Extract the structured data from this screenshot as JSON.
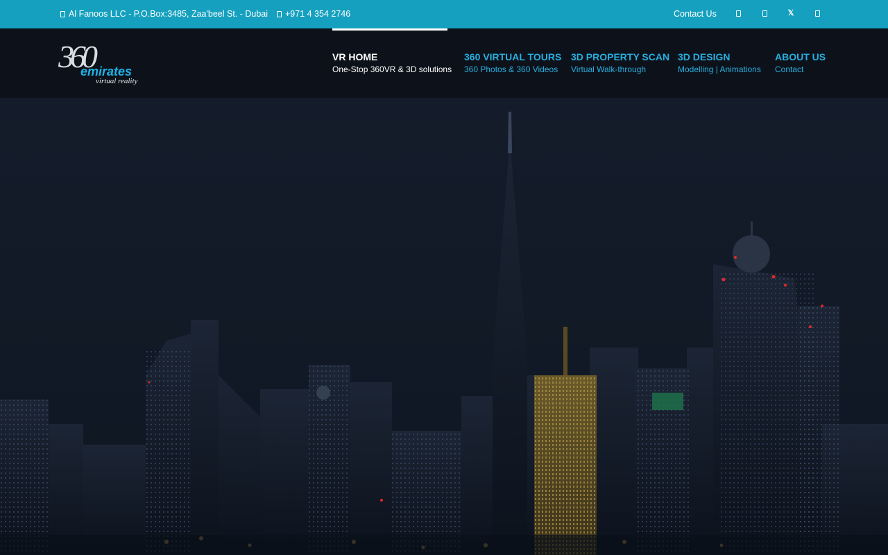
{
  "topbar": {
    "address": "Al Fanoos LLC - P.O.Box:3485, Zaa'beel St. - Dubai",
    "phone": "+971 4 354 2746",
    "contact_label": "Contact Us",
    "address_icon": "map-marker-icon",
    "phone_icon": "phone-icon",
    "social": [
      {
        "icon": "facebook-icon"
      },
      {
        "icon": "instagram-icon"
      },
      {
        "icon": "x-twitter-icon",
        "glyph": "𝕏"
      },
      {
        "icon": "youtube-icon"
      }
    ]
  },
  "logo": {
    "main": "360",
    "brand": "emirates",
    "tagline": "virtual reality"
  },
  "nav": [
    {
      "title": "VR HOME",
      "subtitle": "One-Stop 360VR & 3D solutions",
      "active": true
    },
    {
      "title": "360 VIRTUAL TOURS",
      "subtitle": "360 Photos & 360 Videos",
      "active": false
    },
    {
      "title": "3D PROPERTY SCAN",
      "subtitle": "Virtual Walk-through",
      "active": false
    },
    {
      "title": "3D DESIGN",
      "subtitle": "Modelling | Animations",
      "active": false
    },
    {
      "title": "ABOUT US",
      "subtitle": "Contact",
      "active": false
    }
  ],
  "colors": {
    "topbar_bg": "#15a0bf",
    "header_bg": "#0d121a",
    "nav_link": "#27aee0",
    "nav_active": "#ffffff"
  },
  "hero": {
    "image": "dubai-skyline-night"
  }
}
